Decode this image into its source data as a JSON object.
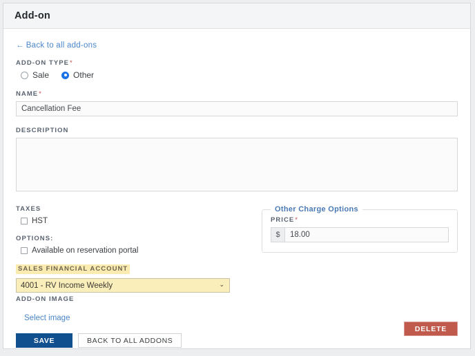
{
  "header": {
    "title": "Add-on"
  },
  "back_link": {
    "arrow": "←",
    "label": "Back to all add-ons"
  },
  "addon_type": {
    "label": "ADD-ON TYPE",
    "required_marker": "*",
    "options": [
      {
        "label": "Sale",
        "selected": false
      },
      {
        "label": "Other",
        "selected": true
      }
    ]
  },
  "name": {
    "label": "NAME",
    "required_marker": "*",
    "value": "Cancellation Fee",
    "placeholder": ""
  },
  "description": {
    "label": "DESCRIPTION",
    "value": "",
    "placeholder": ""
  },
  "taxes": {
    "label": "TAXES",
    "items": [
      {
        "label": "HST",
        "checked": false
      }
    ]
  },
  "options": {
    "label": "OPTIONS:",
    "items": [
      {
        "label": "Available on reservation portal",
        "checked": false
      }
    ]
  },
  "sales_financial_account": {
    "label": "SALES FINANCIAL ACCOUNT",
    "selected": "4001 - RV Income Weekly",
    "chevron": "⌄"
  },
  "other_charge_options": {
    "legend": "Other Charge Options",
    "price": {
      "label": "PRICE",
      "required_marker": "*",
      "currency_symbol": "$",
      "value": "18.00"
    }
  },
  "addon_image": {
    "label": "ADD-ON IMAGE",
    "select_link": "Select image"
  },
  "buttons": {
    "save": "SAVE",
    "back_to_all": "BACK TO ALL ADDONS",
    "delete": "DELETE"
  },
  "colors": {
    "primary": "#10508f",
    "danger": "#c05a4c",
    "link": "#4a86c8",
    "legend": "#4a7ab5",
    "autofill": "#faeebb",
    "required": "#c0504a"
  }
}
